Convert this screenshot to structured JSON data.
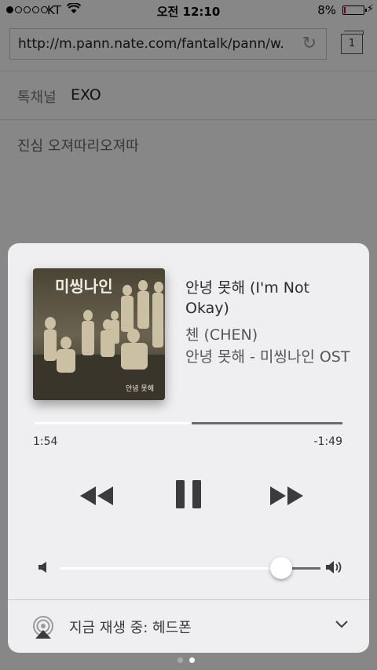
{
  "status_bar": {
    "carrier": "KT",
    "time": "오전 12:10",
    "battery": "8%"
  },
  "browser": {
    "url": "http://m.pann.nate.com/fantalk/pann/w...",
    "tab_count": "1",
    "channel_label": "톡채널",
    "channel_value": "EXO",
    "post_title": "진심 오져따리오져따"
  },
  "now_playing": {
    "title": "안녕 못해 (I'm Not Okay)",
    "artist": "첸 (CHEN)",
    "album": "안녕 못해 - 미씽나인 OST",
    "artwork_title": "미씽나인",
    "artwork_caption": "안녕 못해",
    "elapsed": "1:54",
    "remaining": "-1:49",
    "progress": 0.51,
    "volume": 0.85
  },
  "output": {
    "label": "지금 재생 중: 헤드폰"
  },
  "colors": {
    "accent_white": "#ffffff",
    "track_gray": "#6a6a6a",
    "card_bg": "#efeff1"
  }
}
